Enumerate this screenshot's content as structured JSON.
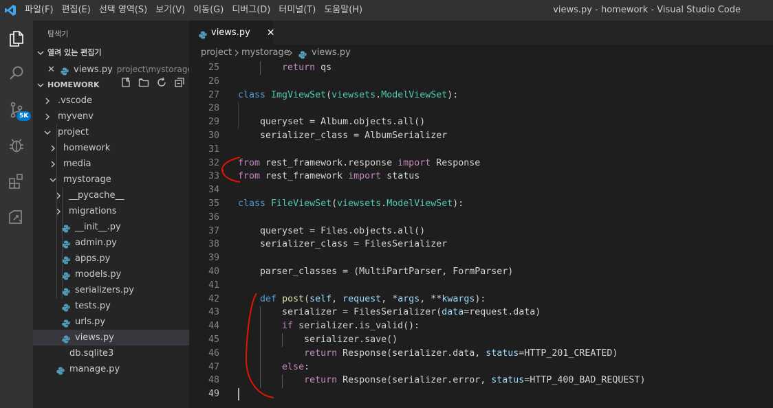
{
  "window": {
    "title": "views.py - homework - Visual Studio Code",
    "menu": [
      "파일(F)",
      "편집(E)",
      "선택 영역(S)",
      "보기(V)",
      "이동(G)",
      "디버그(D)",
      "터미널(T)",
      "도움말(H)"
    ]
  },
  "activity": {
    "scm_badge": "5K",
    "icons": [
      "explorer-icon",
      "search-icon",
      "source-control-icon",
      "debug-icon",
      "extensions-icon",
      "remote-icon"
    ]
  },
  "sidebar": {
    "title": "탐색기",
    "open_editors": {
      "label": "열려 있는 편집기",
      "file": "views.py",
      "path": "project\\mystorage"
    },
    "workspace": "HOMEWORK",
    "tree": [
      {
        "label": ".vscode",
        "type": "folder"
      },
      {
        "label": "myvenv",
        "type": "folder"
      },
      {
        "label": "project",
        "type": "folder-open"
      },
      {
        "label": "homework",
        "type": "folder"
      },
      {
        "label": "media",
        "type": "folder"
      },
      {
        "label": "mystorage",
        "type": "folder-open"
      },
      {
        "label": "__pycache__",
        "type": "folder"
      },
      {
        "label": "migrations",
        "type": "folder"
      },
      {
        "label": "__init__.py",
        "type": "py"
      },
      {
        "label": "admin.py",
        "type": "py"
      },
      {
        "label": "apps.py",
        "type": "py"
      },
      {
        "label": "models.py",
        "type": "py"
      },
      {
        "label": "serializers.py",
        "type": "py"
      },
      {
        "label": "tests.py",
        "type": "py"
      },
      {
        "label": "urls.py",
        "type": "py"
      },
      {
        "label": "views.py",
        "type": "py",
        "selected": true
      },
      {
        "label": "db.sqlite3",
        "type": "file"
      },
      {
        "label": "manage.py",
        "type": "py"
      }
    ]
  },
  "editor": {
    "tab": "views.py",
    "tab_close": "✕",
    "breadcrumb": [
      "project",
      "mystorage",
      "views.py"
    ],
    "line_numbers": [
      "25",
      "26",
      "27",
      "28",
      "29",
      "30",
      "31",
      "32",
      "33",
      "34",
      "35",
      "36",
      "37",
      "38",
      "39",
      "40",
      "41",
      "42",
      "43",
      "44",
      "45",
      "46",
      "47",
      "48",
      "49"
    ],
    "current_line": "49"
  },
  "colors": {
    "accent": "#007acc",
    "annotation": "#e51400",
    "python_icon": "#519aba"
  }
}
